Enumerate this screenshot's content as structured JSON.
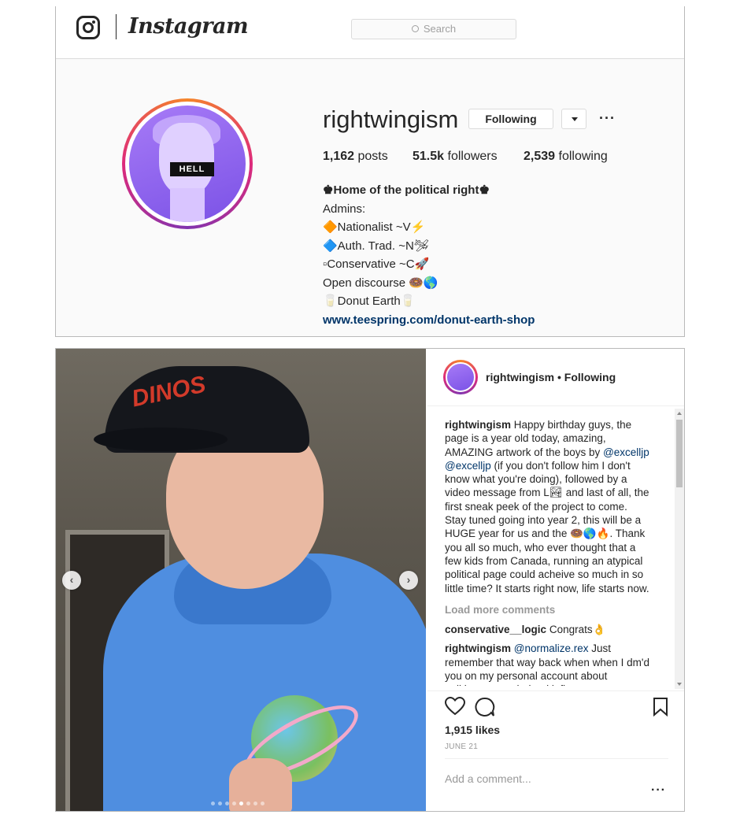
{
  "header": {
    "wordmark": "Instagram",
    "search_placeholder": "Search"
  },
  "profile": {
    "username": "rightwingism",
    "follow_button": "Following",
    "more": "···",
    "avatar_label": "HELL",
    "stats": {
      "posts_count": "1,162",
      "posts_label": "posts",
      "followers_count": "51.5k",
      "followers_label": "followers",
      "following_count": "2,539",
      "following_label": "following"
    },
    "bio": {
      "name": "♚Home of the political right♚",
      "lines": [
        "Admins:",
        "🔶Nationalist ~V⚡",
        "🔷Auth. Trad. ~N🛩",
        "▫Conservative ~C🚀",
        "Open discourse 🍩🌎",
        "🥛Donut Earth🥛"
      ],
      "link": "www.teespring.com/donut-earth-shop"
    }
  },
  "post": {
    "author": "rightwingism",
    "author_status": "• Following",
    "caption_user": "rightwingism",
    "caption_part1": "Happy birthday guys, the page is a year old today, amazing, AMAZING artwork of the boys by",
    "caption_mention1": "@excelljp",
    "caption_mention2": "@excelljp",
    "caption_part2": "(if you don't follow him I don't know what you're doing), followed by a video message from L🏞 and last of all, the first sneak peek of the project to come. Stay tuned going into year 2, this will be a HUGE year for us and the 🍩🌎🔥. Thank you all so much, who ever thought that a few kids from Canada, running an atypical political page could acheive so much in so little time? It starts right now, life starts now.",
    "load_more": "Load more comments",
    "comments": [
      {
        "user": "conservative__logic",
        "mention": "",
        "text": "Congrats👌"
      },
      {
        "user": "rightwingism",
        "mention": "@normalize.rex",
        "text": "Just remember that way back when when I dm'd you on my personal account about politigram, you helped influence me to get"
      }
    ],
    "likes": "1,915 likes",
    "date": "JUNE 21",
    "comment_placeholder": "Add a comment...",
    "more": "···",
    "video_cap_text": "DINOS",
    "carousel": {
      "count": 8,
      "active_index": 4
    }
  },
  "colors": {
    "link": "#003569",
    "avatar_gradient": [
      "#f58529",
      "#dd2a7b",
      "#8134af"
    ],
    "avatar_bg": "#8a5cf0"
  }
}
